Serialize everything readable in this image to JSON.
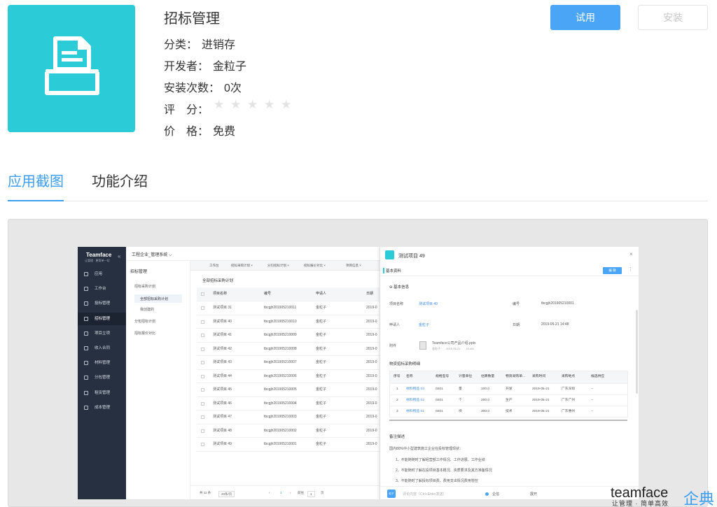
{
  "app": {
    "title": "招标管理",
    "category_label": "分类：",
    "category": "进销存",
    "developer_label": "开发者：",
    "developer": "金粒子",
    "installs_label": "安装次数：",
    "installs": "0次",
    "rating_label": "评　分：",
    "rating": 0,
    "rating_max": 5,
    "price_label": "价　格：",
    "price": "免费",
    "icon": "document-tray-icon",
    "accent_color": "#2ccbd8"
  },
  "actions": {
    "trial_label": "试用",
    "install_label": "安装"
  },
  "tabs": [
    {
      "label": "应用截图",
      "active": true
    },
    {
      "label": "功能介绍",
      "active": false
    }
  ],
  "screenshot": {
    "brand": "Teamface",
    "slogan": "让管理 · 更简单一切",
    "collapse": "«",
    "org": "工程企业_管理系统 ⌵",
    "sidebar": [
      "应用",
      "工作台",
      "投标管理",
      "招标管理",
      "项目立项",
      "收入合同",
      "材料管理",
      "分包管理",
      "租赁管理",
      "成本管理"
    ],
    "sub_title": "招标管理",
    "sub_items": [
      "招标采购计划",
      "全部招标采购计划",
      "我创建的",
      "分包招标计划",
      "招标报价对比"
    ],
    "tabs": [
      "工作台",
      "招标采购计划 ×",
      "分包招标计划 ×",
      "招标报价对比 ×",
      "项目信息 ×"
    ],
    "list_title": "全部招标采购计划",
    "columns": [
      "项目名称",
      "编号",
      "申请人",
      "日期"
    ],
    "rows": [
      [
        "测试项目 31",
        "tbcgjh201905210011",
        "金粒子",
        "2019-0"
      ],
      [
        "测试项目 40",
        "tbcgjh201905210010",
        "金粒子",
        "2019-0"
      ],
      [
        "测试项目 41",
        "tbcgjh201905210009",
        "金粒子",
        "2019-0"
      ],
      [
        "测试项目 42",
        "tbcgjh201905210008",
        "金粒子",
        "2019-0"
      ],
      [
        "测试项目 43",
        "tbcgjh201905210007",
        "金粒子",
        "2019-0"
      ],
      [
        "测试项目 44",
        "tbcgjh201905210006",
        "金粒子",
        "2019-0"
      ],
      [
        "测试项目 45",
        "tbcgjh201905210005",
        "金粒子",
        "2019-0"
      ],
      [
        "测试项目 46",
        "tbcgjh201905210004",
        "金粒子",
        "2019-0"
      ],
      [
        "测试项目 47",
        "tbcgjh201905210003",
        "金粒子",
        "2019-0"
      ],
      [
        "测试项目 48",
        "tbcgjh201905210002",
        "金粒子",
        "2019-0"
      ],
      [
        "测试项目 49",
        "tbcgjh201905210001",
        "金粒子",
        "2019-0"
      ]
    ],
    "footer": {
      "total": "共 11 条",
      "per_page": "20条/页",
      "page": "1",
      "goto": "前往",
      "goto_page": "1",
      "page_suffix": "页"
    },
    "detail": {
      "title": "测试项目 49",
      "close": "×",
      "section": "基本资料",
      "edit": "编 辑",
      "more": "⋮",
      "info_head": "⊖ 基本信息",
      "project_name_label": "项目名称",
      "project_name": "测试项目 49",
      "number_label": "编号",
      "number": "tbcgjh201905210001",
      "applicant_label": "申请人",
      "applicant": "金粒子",
      "date_label": "日期",
      "date": "2019-05-21 14:48",
      "attachment_label": "附件",
      "attachment_name": "Teamface公司产品介绍.pptx",
      "attachment_meta": "金粒子　　2019-05-21　　24.4M",
      "material_head": "物资招标采购明细",
      "material_columns": [
        "序号",
        "名称",
        "规格型号",
        "计量单位",
        "估算数量",
        "物资采购单...",
        "采购时间",
        "采购地点",
        "候选供应"
      ],
      "material_rows": [
        [
          "1",
          "材料物品 03",
          "0201",
          "量",
          "100.0",
          "开发",
          "2019-05-21",
          "广东深圳",
          "--"
        ],
        [
          "2",
          "材料物品 02",
          "0201",
          "个",
          "200.0",
          "生产",
          "2019-05-21",
          "广东广州",
          "--"
        ],
        [
          "3",
          "材料物品 01",
          "0201",
          "块",
          "300.0",
          "技术",
          "2019-05-21",
          "广东惠州",
          "--"
        ]
      ],
      "remark_head": "备注描述",
      "remark_lines": [
        "国内80%中小型建筑施工企业在投标管理现状：",
        "1、不能随随时了解经营部工作情况、工作进展、工作业绩",
        "2、不能随时了解在投项目基本概况、资质要求及其方准备情况",
        "3、不能随时了解投标项目费、费用支出情况费用管控"
      ],
      "comment_placeholder": "评论内容（Ctrl+Enter发送）",
      "comment_user": "粒子",
      "scope": "企信",
      "expand": "展开"
    }
  },
  "watermark": {
    "brand": "teamface",
    "brand_cn": "企典",
    "slogan": "让管理 · 简单高效"
  }
}
